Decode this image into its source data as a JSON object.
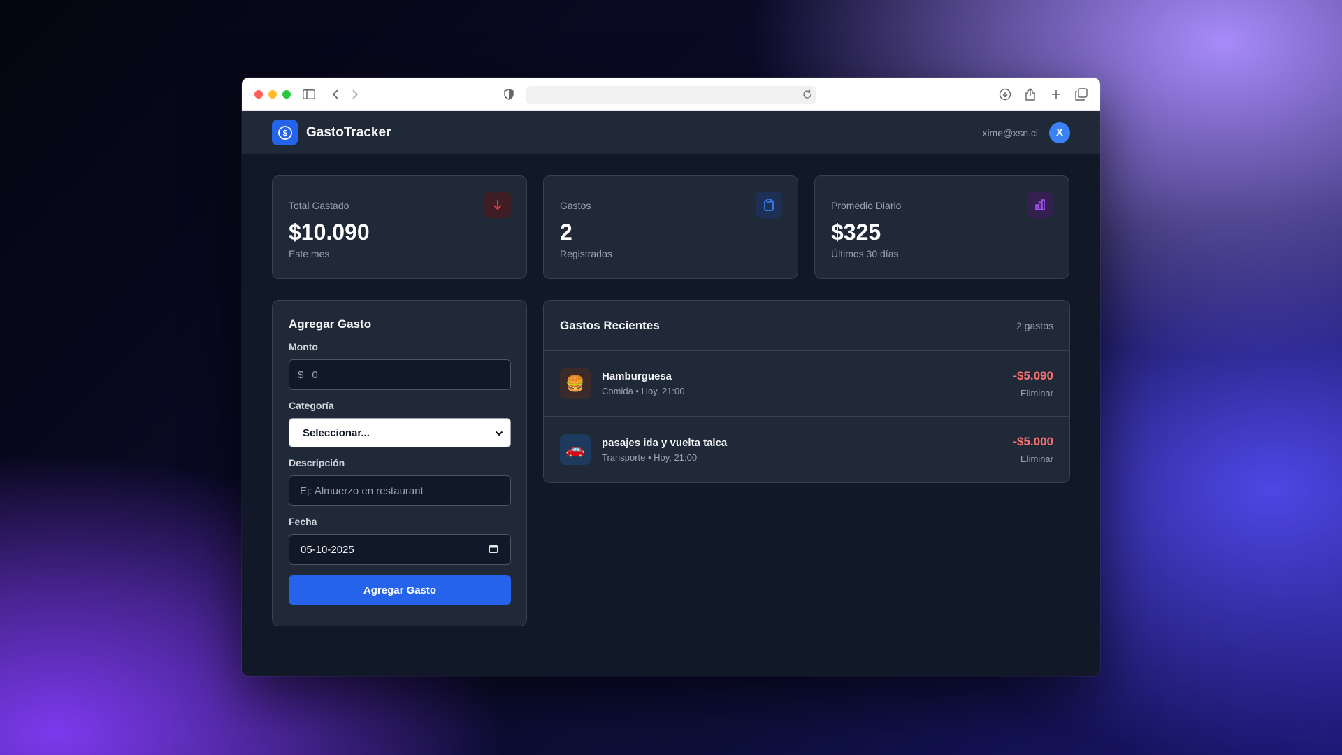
{
  "browser": {
    "url": ""
  },
  "header": {
    "brand": "GastoTracker",
    "user_email": "xime@xsn.cl",
    "avatar_initial": "X"
  },
  "stats": [
    {
      "label": "Total Gastado",
      "value": "$10.090",
      "sub": "Este mes",
      "icon": "arrow-down-icon",
      "accent": "#ef4444"
    },
    {
      "label": "Gastos",
      "value": "2",
      "sub": "Registrados",
      "icon": "clipboard-icon",
      "accent": "#3b82f6"
    },
    {
      "label": "Promedio Diario",
      "value": "$325",
      "sub": "Últimos 30 días",
      "icon": "bar-chart-icon",
      "accent": "#a855f7"
    }
  ],
  "form": {
    "title": "Agregar Gasto",
    "amount_label": "Monto",
    "currency_symbol": "$",
    "amount_placeholder": "0",
    "category_label": "Categoría",
    "category_selected": "Seleccionar...",
    "description_label": "Descripción",
    "description_placeholder": "Ej: Almuerzo en restaurant",
    "date_label": "Fecha",
    "date_value": "05-10-2025",
    "submit_label": "Agregar Gasto"
  },
  "recent": {
    "title": "Gastos Recientes",
    "count_text": "2 gastos",
    "items": [
      {
        "emoji": "🍔",
        "name": "Hamburguesa",
        "meta": "Comida • Hoy, 21:00",
        "amount": "-$5.090",
        "delete_label": "Eliminar"
      },
      {
        "emoji": "🚗",
        "name": "pasajes ida y vuelta talca",
        "meta": "Transporte • Hoy, 21:00",
        "amount": "-$5.000",
        "delete_label": "Eliminar"
      }
    ]
  },
  "colors": {
    "primary": "#2563eb",
    "negative": "#f87171",
    "card_bg": "#1f2937",
    "page_bg": "#111827"
  }
}
